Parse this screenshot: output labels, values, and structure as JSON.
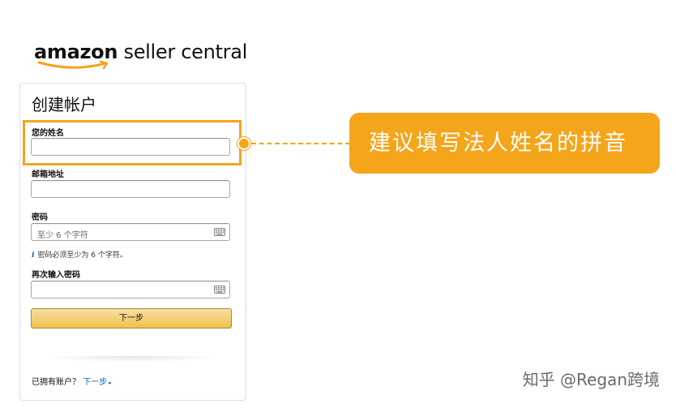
{
  "logo": {
    "brand": "amazon",
    "product": " seller central"
  },
  "form": {
    "title": "创建帐户",
    "name_label": "您的姓名",
    "name_value": "",
    "email_label": "邮箱地址",
    "email_value": "",
    "password_label": "密码",
    "password_placeholder": "至少 6 个字符",
    "password_hint_icon": "i",
    "password_hint": "密码必须至少为 6 个字符。",
    "confirm_label": "再次输入密码",
    "confirm_value": "",
    "next_button": "下一步",
    "have_account": "已拥有账户？",
    "signin_link": "下一步",
    "signin_caret": "▸"
  },
  "annotation": {
    "callout_text": "建议填写法人姓名的拼音"
  },
  "watermark": "知乎 @Regan跨境",
  "colors": {
    "accent_orange": "#f5a51a",
    "link_blue": "#0066c0",
    "button_yellow": "#f0c14b"
  }
}
